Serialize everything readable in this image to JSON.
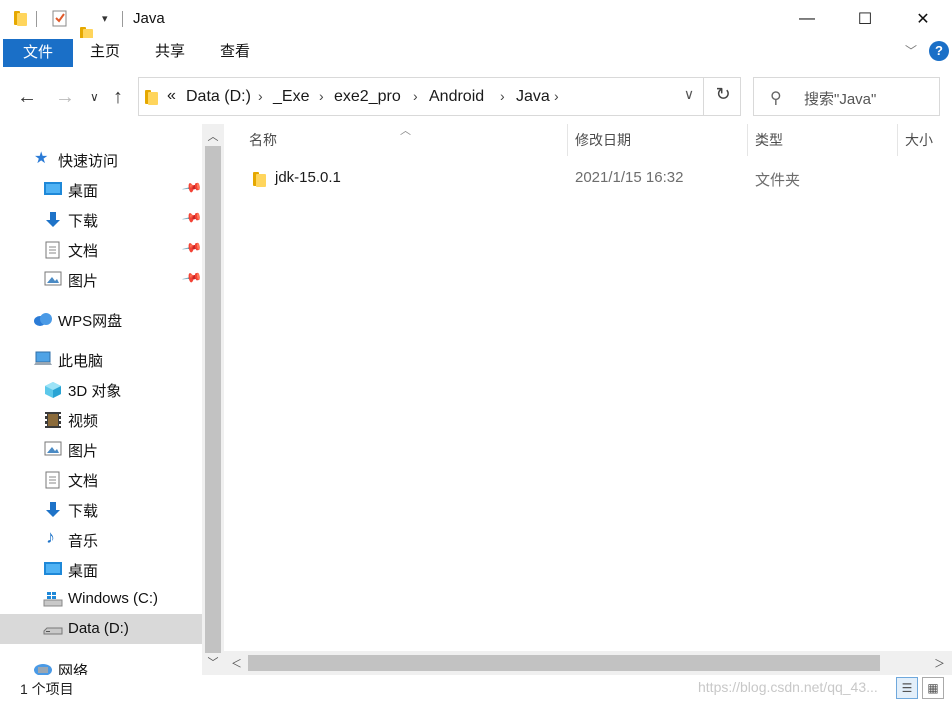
{
  "window": {
    "title": "Java",
    "minimize_glyph": "—",
    "maximize_glyph": "☐",
    "close_glyph": "✕"
  },
  "ribbon": {
    "tabs": [
      {
        "label": "文件",
        "active": true
      },
      {
        "label": "主页"
      },
      {
        "label": "共享"
      },
      {
        "label": "查看"
      }
    ],
    "help_glyph": "?",
    "accent_color": "#1a6fc7"
  },
  "address": {
    "overflow_marker": "«",
    "breadcrumbs": [
      "Data (D:)",
      "_Exe",
      "exe2_pro",
      "Android",
      "Java"
    ],
    "search_placeholder": "搜索\"Java\""
  },
  "sidebar": {
    "items": [
      {
        "label": "快速访问",
        "icon": "star-icon",
        "level": 0
      },
      {
        "label": "桌面",
        "icon": "desktop-icon",
        "level": 1,
        "pinned": true
      },
      {
        "label": "下载",
        "icon": "download-icon",
        "level": 1,
        "pinned": true
      },
      {
        "label": "文档",
        "icon": "document-icon",
        "level": 1,
        "pinned": true
      },
      {
        "label": "图片",
        "icon": "picture-icon",
        "level": 1,
        "pinned": true
      },
      {
        "label": "WPS网盘",
        "icon": "cloud-icon",
        "level": 0
      },
      {
        "label": "此电脑",
        "icon": "computer-icon",
        "level": 0
      },
      {
        "label": "3D 对象",
        "icon": "cube-icon",
        "level": 1
      },
      {
        "label": "视频",
        "icon": "video-icon",
        "level": 1
      },
      {
        "label": "图片",
        "icon": "picture-icon",
        "level": 1
      },
      {
        "label": "文档",
        "icon": "document-icon",
        "level": 1
      },
      {
        "label": "下载",
        "icon": "download-icon",
        "level": 1
      },
      {
        "label": "音乐",
        "icon": "music-icon",
        "level": 1
      },
      {
        "label": "桌面",
        "icon": "desktop-icon",
        "level": 1
      },
      {
        "label": "Windows (C:)",
        "icon": "windows-drive-icon",
        "level": 1
      },
      {
        "label": "Data (D:)",
        "icon": "drive-icon",
        "level": 1,
        "selected": true
      },
      {
        "label": "网络",
        "icon": "network-icon",
        "level": 0
      }
    ]
  },
  "filelist": {
    "columns": [
      "名称",
      "修改日期",
      "类型",
      "大小"
    ],
    "rows": [
      {
        "name": "jdk-15.0.1",
        "modified": "2021/1/15 16:32",
        "type": "文件夹",
        "size": ""
      }
    ]
  },
  "status": {
    "item_count": "1 个项目",
    "watermark": "https://blog.csdn.net/qq_43..."
  }
}
